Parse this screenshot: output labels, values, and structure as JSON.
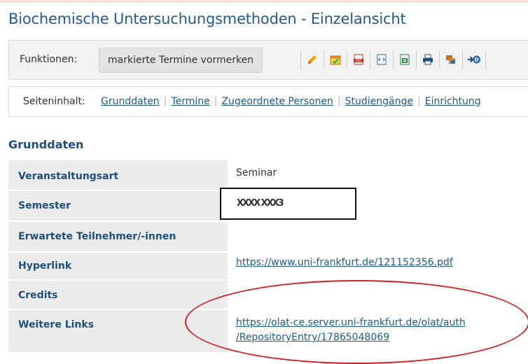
{
  "header": {
    "title": "Biochemische Untersuchungsmethoden - Einzelansicht"
  },
  "functions": {
    "label": "Funktionen:",
    "reserve_button": "markierte Termine vormerken",
    "icons": [
      "edit-pencil-icon",
      "calendar-icon",
      "pdf-icon",
      "html-export-icon",
      "excel-icon",
      "print-icon",
      "export-stack-icon",
      "dlink-icon"
    ]
  },
  "page_content": {
    "label": "Seiteninhalt:",
    "links": [
      "Grunddaten",
      "Termine",
      "Zugeordnete Personen",
      "Studiengänge",
      "Einrichtung"
    ]
  },
  "section": {
    "title": "Grunddaten"
  },
  "rows": {
    "type": {
      "label": "Veranstaltungsart",
      "value": "Seminar"
    },
    "semester": {
      "label": "Semester",
      "value": "XXXX XXX3"
    },
    "participants": {
      "label": "Erwartete Teilnehmer/-innen",
      "value": ""
    },
    "hyperlink": {
      "label": "Hyperlink",
      "value": "https://www.uni-frankfurt.de/121152356.pdf"
    },
    "credits": {
      "label": "Credits",
      "value": ""
    },
    "links": {
      "label": "Weitere Links",
      "line1": "https://olat-ce.server.uni-frankfurt.de/olat/auth",
      "line2": "/RepositoryEntry/17865048069"
    }
  },
  "colors": {
    "title": "#1f5b8c",
    "label_bg": "#ececec",
    "annotation_circle": "#d21f26"
  }
}
